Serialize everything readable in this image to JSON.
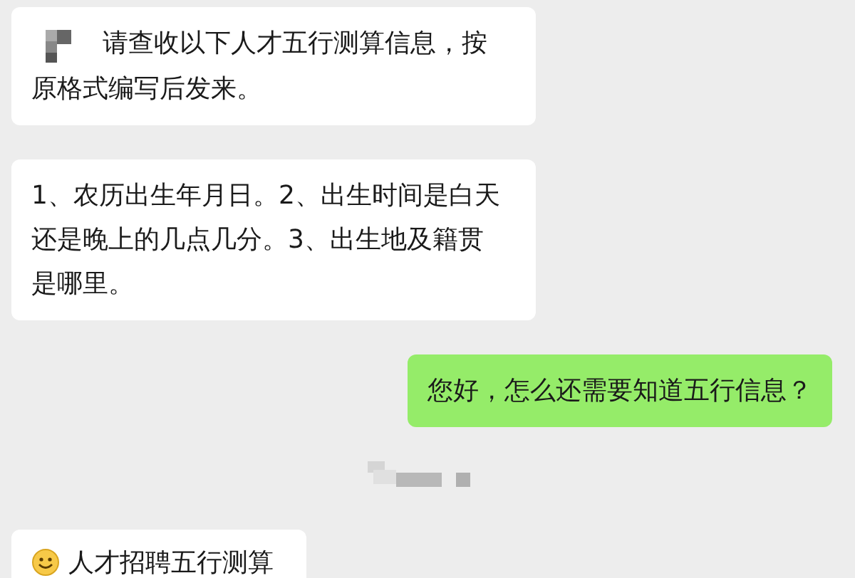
{
  "messages": [
    {
      "kind": "mosaic_text",
      "outgoing": false,
      "text": "请查收以下人才五行测算信息，按原格式编写后发来。"
    },
    {
      "kind": "text",
      "outgoing": false,
      "text": "1、农历出生年月日。2、出生时间是白天还是晚上的几点几分。3、出生地及籍贯是哪里。"
    },
    {
      "kind": "text",
      "outgoing": true,
      "text": "您好，怎么还需要知道五行信息？"
    },
    {
      "kind": "redacted"
    },
    {
      "kind": "emoji_text",
      "outgoing": false,
      "text": "人才招聘五行测算"
    }
  ]
}
